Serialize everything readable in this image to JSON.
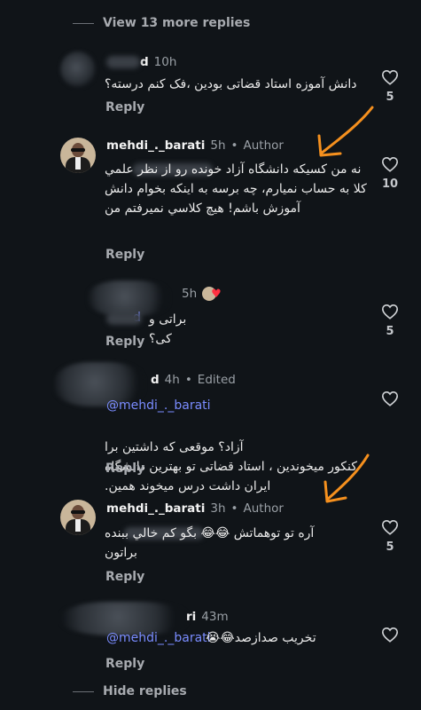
{
  "thread": {
    "view_more": "View 13 more replies",
    "hide": "Hide replies"
  },
  "colors": {
    "background": "#101418",
    "mention": "#7a8cff",
    "arrow": "#f5901e",
    "heart": "#ff3040"
  },
  "comments": [
    {
      "user_suffix": "d",
      "time": "10h",
      "text": "دانش آموزه استاد قضاتی بودین ،فک کنم درسته؟",
      "reply": "Reply",
      "likes": "5"
    },
    {
      "user": "mehdi_._barati",
      "time": "5h",
      "author": "Author",
      "text": "نه من کسیکه دانشگاه آزاد خونده رو از نظر علمي كلا به حساب نمیارم، چه برسه به اینکه بخوام دانش آموزش باشم! هیچ کلاسي نمیرفتم من",
      "reply": "Reply",
      "likes": "10"
    },
    {
      "time": "5h",
      "user_suffix": "d",
      "text": "براتی و کی؟",
      "reply": "Reply",
      "likes": "5"
    },
    {
      "user_suffix": "d",
      "time": "4h",
      "edited": "Edited",
      "mention": "@mehdi_._barati",
      "text": "آزاد؟ موقعی که داشتین برا کنکور میخوندین ، استاد قضاتی تو بهترین دانشگاه ایران داشت درس میخوند همین.",
      "reply": "Reply",
      "likes": ""
    },
    {
      "user": "mehdi_._barati",
      "time": "3h",
      "author": "Author",
      "text": "آره تو توهماتش 😂😂 بگو کم خالي ببنده براتون",
      "reply": "Reply",
      "likes": "5"
    },
    {
      "user_suffix": "ri",
      "time": "43m",
      "mention": "@mehdi_._barati",
      "text": "تخریب صدازصد😂😭",
      "reply": "Reply",
      "likes": ""
    }
  ],
  "icons": {
    "like": "heart-outline-icon",
    "arrow": "orange-arrow-annotation"
  }
}
